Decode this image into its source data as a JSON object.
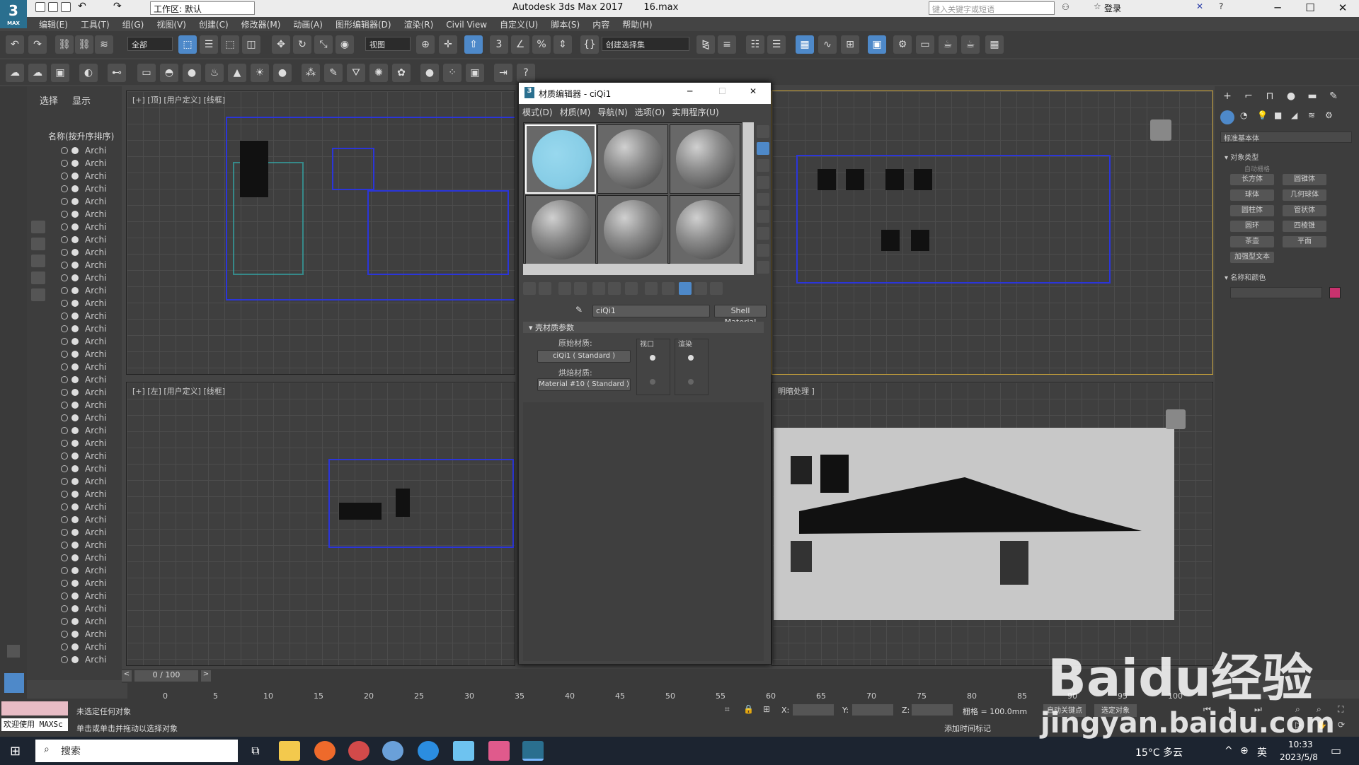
{
  "app": {
    "logo": "3",
    "logo_sub": "MAX",
    "title": "Autodesk 3ds Max 2017",
    "file": "16.max",
    "workspace": "工作区: 默认",
    "search_placeholder": "键入关键字或短语",
    "login": "登录"
  },
  "menu": [
    "编辑(E)",
    "工具(T)",
    "组(G)",
    "视图(V)",
    "创建(C)",
    "修改器(M)",
    "动画(A)",
    "图形编辑器(D)",
    "渲染(R)",
    "Civil View",
    "自定义(U)",
    "脚本(S)",
    "内容",
    "帮助(H)"
  ],
  "toolbar": {
    "filter": "全部",
    "view": "视图",
    "selection_set": "创建选择集"
  },
  "scene_explorer": {
    "tab_select": "选择",
    "tab_display": "显示",
    "header": "名称(按升序排序)",
    "item_label": "Archi",
    "rows": 41
  },
  "viewports": {
    "top": "[+] [顶] [用户定义] [线框]",
    "left": "[+] [左] [用户定义] [线框]",
    "persp_tail": "明暗处理 ]"
  },
  "material_editor": {
    "icon": "3",
    "title": "材质编辑器 - ciQi1",
    "menu": [
      "模式(D)",
      "材质(M)",
      "导航(N)",
      "选项(O)",
      "实用程序(U)"
    ],
    "material_name": "ciQi1",
    "material_type": "Shell Material",
    "rollout": "壳材质参数",
    "original_label": "原始材质:",
    "original_value": "ciQi1 ( Standard )",
    "baked_label": "烘焙材质:",
    "baked_value": "Material #10 ( Standard )",
    "viewport_label": "视口",
    "render_label": "渲染"
  },
  "command_panel": {
    "category": "标准基本体",
    "section1": "对象类型",
    "autogrid": "自动栅格",
    "buttons": [
      "长方体",
      "圆锥体",
      "球体",
      "几何球体",
      "圆柱体",
      "管状体",
      "圆环",
      "四棱锥",
      "茶壶",
      "平面",
      "加强型文本"
    ],
    "section2": "名称和颜色",
    "swatch": "#c8326e"
  },
  "timeline": {
    "frame": "0 / 100",
    "ticks": [
      "0",
      "5",
      "10",
      "15",
      "20",
      "25",
      "30",
      "35",
      "40",
      "45",
      "50",
      "55",
      "60",
      "65",
      "70",
      "75",
      "80",
      "85",
      "90",
      "95",
      "100"
    ]
  },
  "status": {
    "maxscript": "欢迎使用 MAXSc",
    "line1": "未选定任何对象",
    "line2": "单击或单击并拖动以选择对象",
    "x": "X:",
    "y": "Y:",
    "z": "Z:",
    "grid": "栅格 = 100.0mm",
    "autokey": "自动关键点",
    "setkey": "选定对象",
    "add_tag": "添加时间标记"
  },
  "taskbar": {
    "search": "搜索",
    "weather": "15°C 多云",
    "lang": "英",
    "time": "10:33",
    "date": "2023/5/8"
  },
  "watermark": {
    "brand": "Baidu经验",
    "url": "jingyan.baidu.com"
  }
}
